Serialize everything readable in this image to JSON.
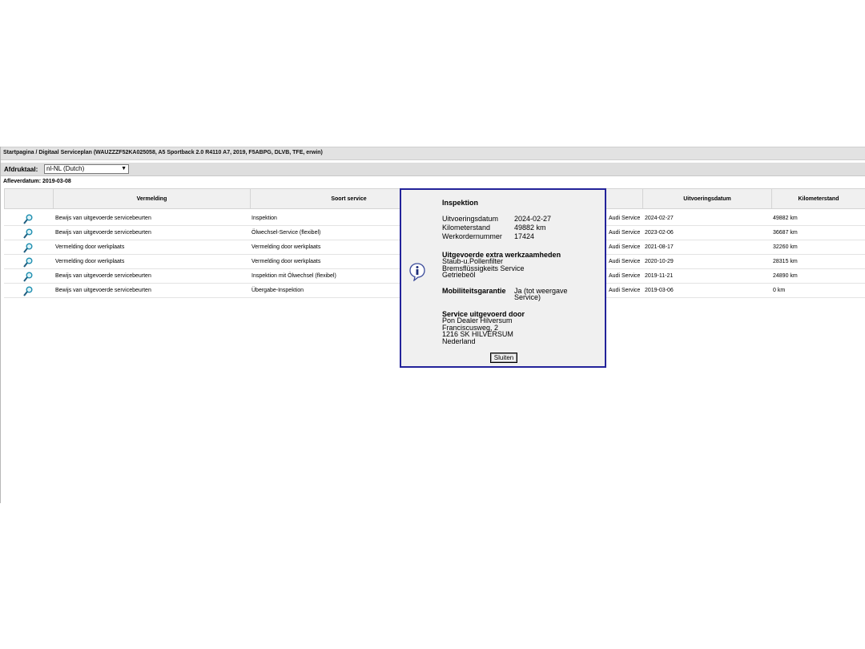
{
  "breadcrumb": "Startpagina / Digitaal Serviceplan (WAUZZZF52KA025058, A5 Sportback 2.0 R4110 A7, 2019, F5ABPG, DLVB, TFE, erwin)",
  "language": {
    "label": "Afdruktaal:",
    "selected": "nl-NL (Dutch)"
  },
  "delivery_date": "Afleverdatum: 2019-03-08",
  "table": {
    "headers": {
      "vermelding": "Vermelding",
      "soort_service": "Soort service",
      "uitvoeringsdatum": "Uitvoeringsdatum",
      "kilometerstand": "Kilometerstand"
    },
    "rows": [
      {
        "vermelding": "Bewijs van uitgevoerde servicebeurten",
        "soort": "Inspektion",
        "dealer": "Audi Service",
        "datum": "2024-02-27",
        "km": "49882 km"
      },
      {
        "vermelding": "Bewijs van uitgevoerde servicebeurten",
        "soort": "Ölwechsel-Service (flexibel)",
        "dealer": "Audi Service",
        "datum": "2023-02-06",
        "km": "36687 km"
      },
      {
        "vermelding": "Vermelding door werkplaats",
        "soort": "Vermelding door werkplaats",
        "dealer": "Audi Service",
        "datum": "2021-08-17",
        "km": "32260 km"
      },
      {
        "vermelding": "Vermelding door werkplaats",
        "soort": "Vermelding door werkplaats",
        "dealer": "Audi Service",
        "datum": "2020-10-29",
        "km": "28315 km"
      },
      {
        "vermelding": "Bewijs van uitgevoerde servicebeurten",
        "soort": "Inspektion mit Ölwechsel (flexibel)",
        "dealer": "Audi Service",
        "datum": "2019-11-21",
        "km": "24890 km"
      },
      {
        "vermelding": "Bewijs van uitgevoerde servicebeurten",
        "soort": "Übergabe-Inspektion",
        "dealer": "Audi Service",
        "datum": "2019-03-06",
        "km": "0 km"
      }
    ]
  },
  "popup": {
    "title": "Inspektion",
    "fields": [
      {
        "label": "Uitvoeringsdatum",
        "value": "2024-02-27"
      },
      {
        "label": "Kilometerstand",
        "value": "49882 km"
      },
      {
        "label": "Werkordernummer",
        "value": "17424"
      }
    ],
    "extra_title": "Uitgevoerde extra werkzaamheden",
    "extra_items": [
      "Staub-u.Pollenfilter",
      "Bremsflüssigkeits Service",
      "Getriebeöl"
    ],
    "mobility_label": "Mobiliteitsgarantie",
    "mobility_value_1": "Ja (tot weergave",
    "mobility_value_2": "Service)",
    "service_title": "Service uitgevoerd door",
    "service_lines": [
      "Pon Dealer Hilversum",
      "Franciscusweg, 2",
      "1216 SK HILVERSUM",
      "Nederland"
    ],
    "close_label": "Sluiten"
  },
  "colors": {
    "popup_border": "#23239a",
    "magnifier": "#1f8fb0"
  }
}
